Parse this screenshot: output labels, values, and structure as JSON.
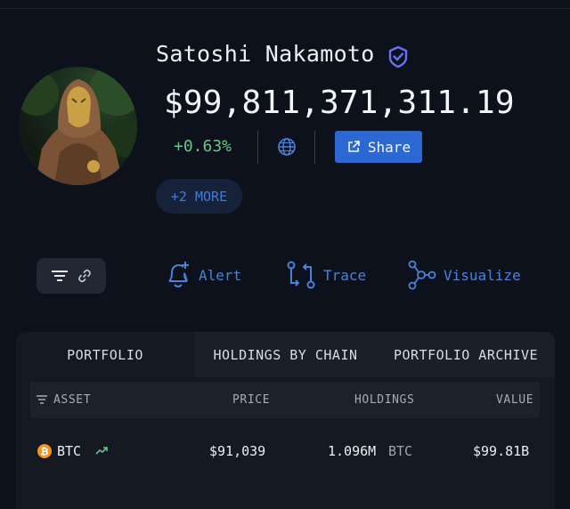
{
  "profile": {
    "name": "Satoshi Nakamoto",
    "balance": "$99,811,371,311.19",
    "change": "+0.63%",
    "share_label": "Share",
    "more_label": "+2 MORE"
  },
  "actions": {
    "alert": "Alert",
    "trace": "Trace",
    "visualize": "Visualize"
  },
  "tabs": [
    {
      "label": "PORTFOLIO",
      "active": true
    },
    {
      "label": "HOLDINGS BY CHAIN",
      "active": false
    },
    {
      "label": "PORTFOLIO ARCHIVE",
      "active": false
    }
  ],
  "table": {
    "headers": {
      "asset": "ASSET",
      "price": "PRICE",
      "holdings": "HOLDINGS",
      "value": "VALUE"
    },
    "rows": [
      {
        "asset": "BTC",
        "price": "$91,039",
        "holdings": "1.096M",
        "holdings_unit": "BTC",
        "value": "$99.81B"
      }
    ]
  },
  "colors": {
    "background": "#0c111b",
    "accent": "#2c68d4",
    "positive": "#6cc389",
    "link": "#4a82d8",
    "btc": "#f7931a"
  }
}
